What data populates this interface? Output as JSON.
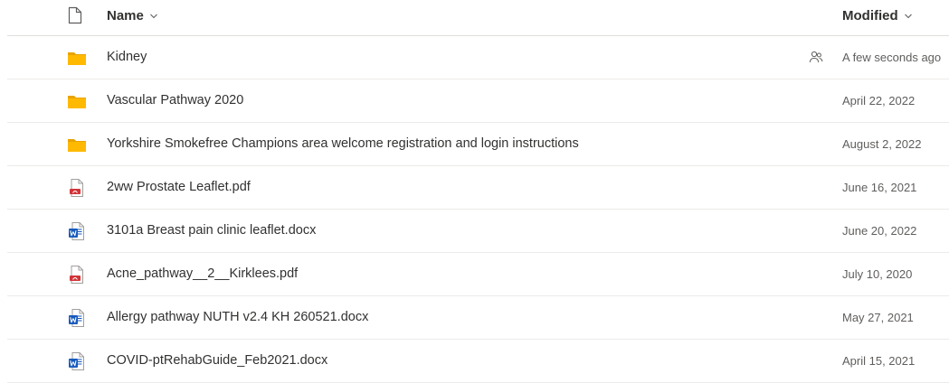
{
  "header": {
    "name_label": "Name",
    "modified_label": "Modified"
  },
  "colors": {
    "folder": "#ffb900",
    "folder_dark": "#e8a300",
    "word": "#185abd",
    "pdf": "#d13438",
    "text": "#323130",
    "muted": "#605e5c"
  },
  "files": [
    {
      "name": "Kidney",
      "modified": "A few seconds ago",
      "type": "folder",
      "icon": "folder-icon",
      "shared": true
    },
    {
      "name": "Vascular Pathway 2020",
      "modified": "April 22, 2022",
      "type": "folder",
      "icon": "folder-icon",
      "shared": false
    },
    {
      "name": "Yorkshire Smokefree Champions area welcome registration and login instructions",
      "modified": "August 2, 2022",
      "type": "folder",
      "icon": "folder-icon",
      "shared": false
    },
    {
      "name": "2ww Prostate Leaflet.pdf",
      "modified": "June 16, 2021",
      "type": "pdf",
      "icon": "pdf-file-icon",
      "shared": false
    },
    {
      "name": "3101a Breast pain clinic leaflet.docx",
      "modified": "June 20, 2022",
      "type": "docx",
      "icon": "word-file-icon",
      "shared": false
    },
    {
      "name": "Acne_pathway__2__Kirklees.pdf",
      "modified": "July 10, 2020",
      "type": "pdf",
      "icon": "pdf-file-icon",
      "shared": false
    },
    {
      "name": "Allergy pathway NUTH v2.4 KH 260521.docx",
      "modified": "May 27, 2021",
      "type": "docx",
      "icon": "word-file-icon",
      "shared": false
    },
    {
      "name": "COVID-ptRehabGuide_Feb2021.docx",
      "modified": "April 15, 2021",
      "type": "docx",
      "icon": "word-file-icon",
      "shared": false
    }
  ]
}
